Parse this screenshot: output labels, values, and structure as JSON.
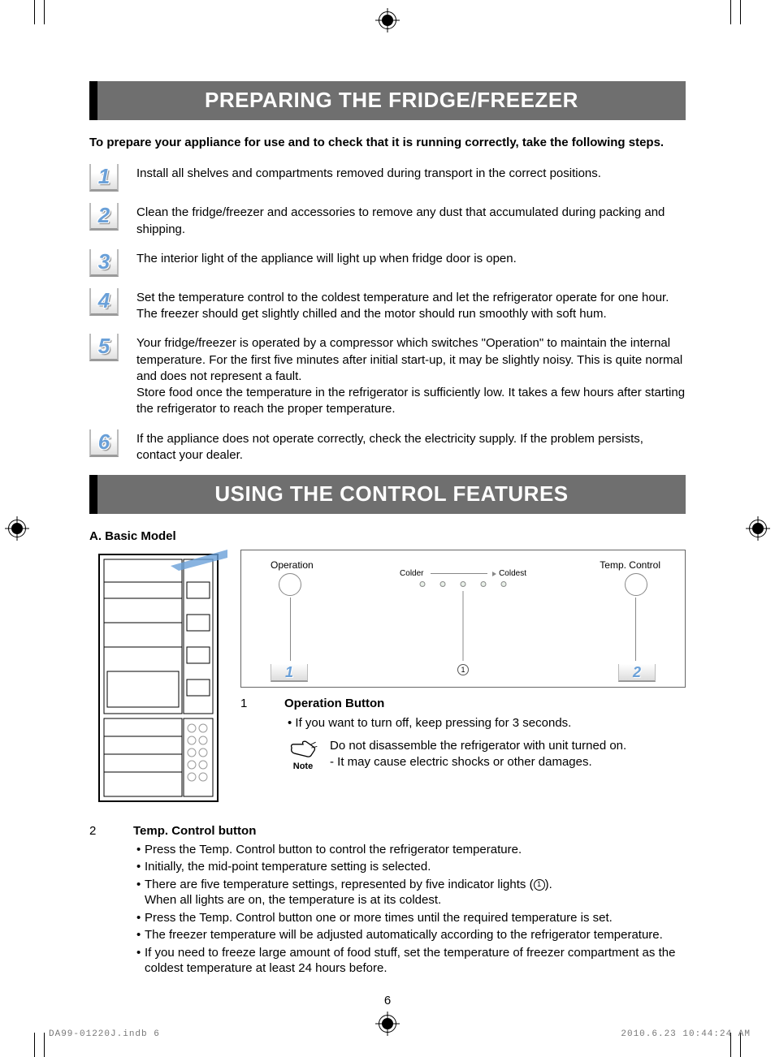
{
  "section1": {
    "title": "PREPARING THE FRIDGE/FREEZER",
    "intro": "To prepare your appliance for use and to check that it is running correctly, take the following steps.",
    "steps": [
      {
        "n": "1",
        "text": "Install all shelves and compartments removed during transport in the correct positions."
      },
      {
        "n": "2",
        "text": "Clean the fridge/freezer and accessories to remove any dust that accumulated during packing and shipping."
      },
      {
        "n": "3",
        "text": "The interior light of the appliance will light up when fridge door is open."
      },
      {
        "n": "4",
        "text": "Set the temperature control to the coldest temperature and let the refrigerator operate for one hour. The freezer should get slightly chilled and the motor should run smoothly with soft hum."
      },
      {
        "n": "5",
        "text": "Your fridge/freezer is operated by a compressor which switches \"Operation\" to maintain the internal temperature. For the first five minutes after initial start-up, it may be slightly noisy. This is quite normal and does not represent a fault.\nStore food once the temperature in the refrigerator is sufficiently low. It takes a few hours after starting the refrigerator to reach the proper temperature."
      },
      {
        "n": "6",
        "text": "If the appliance does not operate correctly, check the electricity supply. If the problem persists, contact your dealer."
      }
    ]
  },
  "section2": {
    "title": "USING THE CONTROL FEATURES",
    "subhead": "A. Basic Model",
    "panel": {
      "operation": "Operation",
      "tempControl": "Temp. Control",
      "colder": "Colder",
      "coldest": "Coldest",
      "tag1": "1",
      "tag2": "2",
      "indicator": "1"
    },
    "op": {
      "n": "1",
      "title": "Operation Button",
      "bullet": "• If you want to turn off, keep pressing for 3 seconds.",
      "noteLabel": "Note",
      "noteLine1": "Do not disassemble the refrigerator with unit turned on.",
      "noteLine2": "- It may cause electric shocks or other damages."
    },
    "temp": {
      "n": "2",
      "title": "Temp. Control button",
      "bullets": [
        "Press the Temp. Control button to control the refrigerator temperature.",
        "Initially, the mid-point temperature setting is selected.",
        "There are five temperature settings, represented by five indicator lights (①).",
        "Press the Temp. Control button one or more times until the required temperature is set.",
        "The freezer temperature will be adjusted automatically according to the refrigerator temperature.",
        "If you need to freeze large amount of food stuff, set the temperature of freezer compartment as the coldest temperature at least 24 hours before."
      ],
      "bullet3sub": "When all lights are on, the temperature is at its coldest."
    }
  },
  "pageNumber": "6",
  "footer": {
    "left": "DA99-01220J.indb   6",
    "right": "2010.6.23   10:44:24 AM"
  }
}
